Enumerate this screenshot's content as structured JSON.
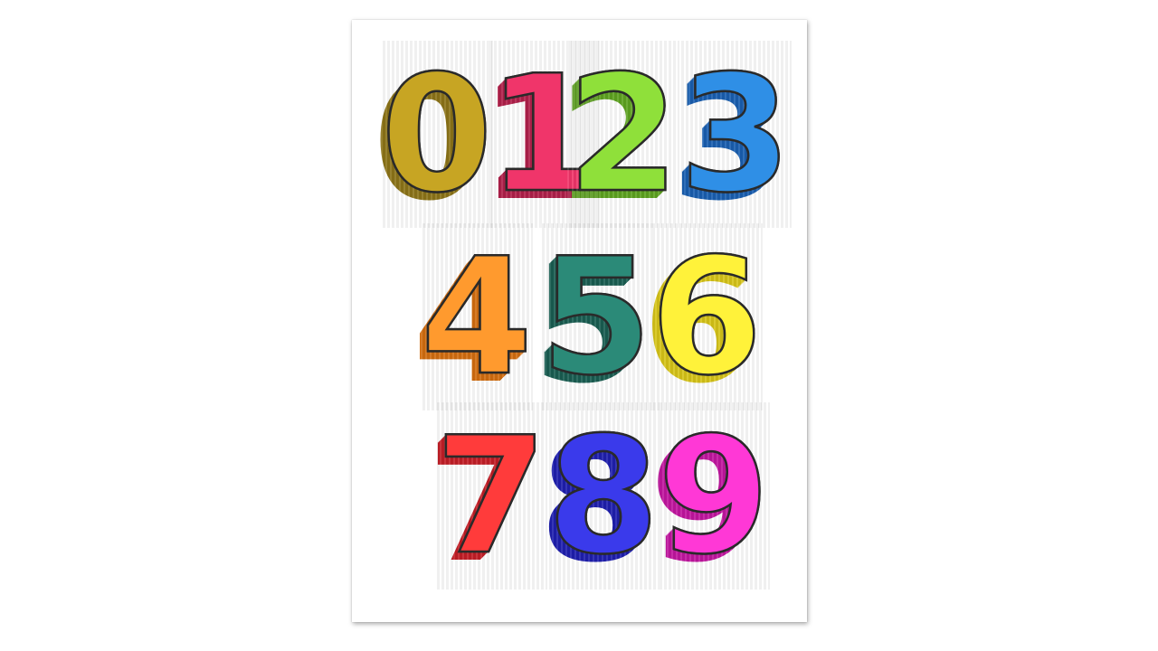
{
  "numbers_sheet": {
    "digits": [
      {
        "label": "0",
        "color": "#c7a523",
        "shade": "#8c7418"
      },
      {
        "label": "1",
        "color": "#f0356a",
        "shade": "#b0204a"
      },
      {
        "label": "2",
        "color": "#8fe03a",
        "shade": "#5ea320"
      },
      {
        "label": "3",
        "color": "#2f8fe6",
        "shade": "#1a5fb0"
      },
      {
        "label": "4",
        "color": "#ff9a2e",
        "shade": "#d26d10"
      },
      {
        "label": "5",
        "color": "#2b8a78",
        "shade": "#1a5e52"
      },
      {
        "label": "6",
        "color": "#fff23a",
        "shade": "#d6c418"
      },
      {
        "label": "7",
        "color": "#ff3b3b",
        "shade": "#c21e26"
      },
      {
        "label": "8",
        "color": "#3a3aeb",
        "shade": "#1f1fae"
      },
      {
        "label": "9",
        "color": "#ff38d6",
        "shade": "#c1169f"
      }
    ],
    "outline_color": "#2a2a2a",
    "paper_color": "#ffffff"
  }
}
